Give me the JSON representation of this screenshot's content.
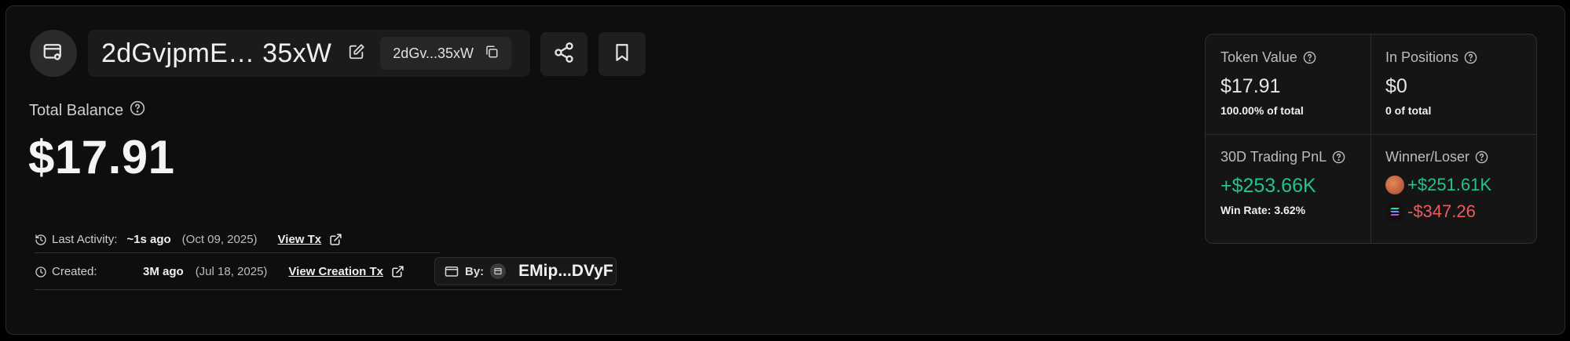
{
  "header": {
    "wallet_name": "2dGvjpmE… 35xW",
    "short_address": "2dGv...35xW"
  },
  "balance": {
    "label": "Total Balance",
    "value": "$17.91"
  },
  "activity": {
    "last_label": "Last Activity:",
    "last_value": "~1s ago",
    "last_date": "(Oct 09, 2025)",
    "view_tx": "View Tx",
    "created_label": "Created:",
    "created_value": "3M ago",
    "created_date": "(Jul 18, 2025)",
    "view_creation_tx": "View Creation Tx",
    "by_label": "By:",
    "by_address": "EMip...DVyF"
  },
  "stats": {
    "token_value": {
      "label": "Token Value",
      "value": "$17.91",
      "sub": "100.00% of total"
    },
    "in_positions": {
      "label": "In Positions",
      "value": "$0",
      "sub": "0 of total"
    },
    "pnl": {
      "label": "30D Trading PnL",
      "value": "+$253.66K",
      "sub": "Win Rate: 3.62%"
    },
    "winner_loser": {
      "label": "Winner/Loser",
      "winner": "+$251.61K",
      "loser": "-$347.26"
    }
  },
  "colors": {
    "positive": "#22c48a",
    "negative": "#f0595f",
    "background": "#0e0e0e"
  },
  "icons": [
    "wallet-icon",
    "edit-icon",
    "copy-icon",
    "share-icon",
    "bookmark-icon",
    "help-icon",
    "history-icon",
    "clock-icon",
    "external-link-icon",
    "wallet-small-icon",
    "token-coin-icon",
    "solana-coin-icon"
  ]
}
